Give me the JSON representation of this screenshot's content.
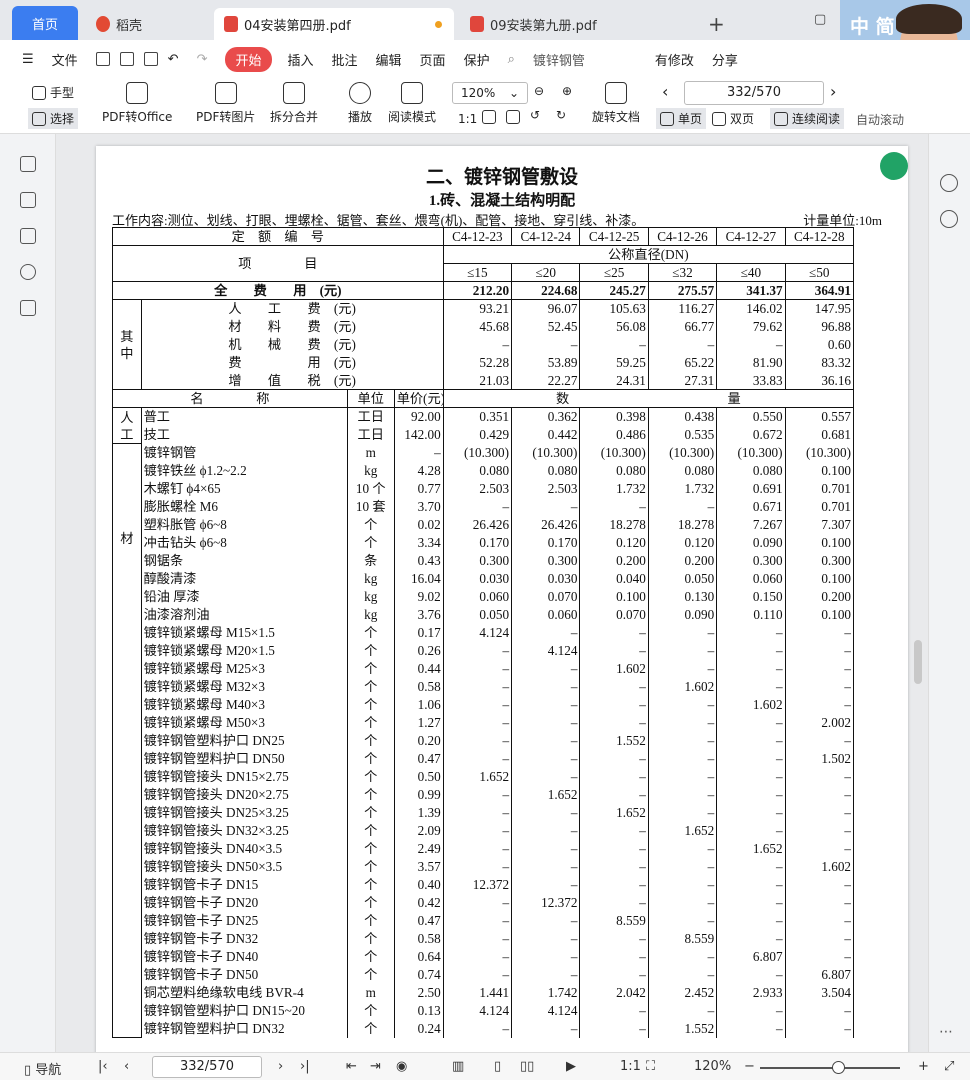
{
  "tabs": {
    "home": "首页",
    "daoke": "稻壳",
    "doc4": "04安装第四册.pdf",
    "doc9": "09安装第九册.pdf",
    "new": "+"
  },
  "menu": {
    "file": "文件",
    "start": "开始",
    "insert": "插入",
    "annotate": "批注",
    "edit": "编辑",
    "page": "页面",
    "protect": "保护",
    "search_text": "镀锌钢管",
    "modified": "有修改",
    "share": "分享"
  },
  "toolbar": {
    "hand": "手型",
    "select": "选择",
    "pdf_office": "PDF转Office",
    "pdf_image": "PDF转图片",
    "split": "拆分合并",
    "play": "播放",
    "read": "阅读模式",
    "zoom": "120%",
    "page_counter": "332/570",
    "rotate": "旋转文档",
    "single": "单页",
    "double": "双页",
    "continuous": "连续阅读",
    "autoscroll": "自动滚动"
  },
  "avatar": {
    "text": "中 简"
  },
  "doc": {
    "title": "二、镀锌钢管敷设",
    "subtitle": "1.砖、混凝土结构明配",
    "work": "工作内容:测位、划线、打眼、埋螺栓、锯管、套丝、煨弯(机)、配管、接地、穿引线、补漆。",
    "unit": "计量单位:10m",
    "codes_label": "定　额　编　号",
    "codes": [
      "C4-12-23",
      "C4-12-24",
      "C4-12-25",
      "C4-12-26",
      "C4-12-27",
      "C4-12-28"
    ],
    "item_label": "项　　　　目",
    "diameter_label": "公称直径(DN)",
    "diameters": [
      "≤15",
      "≤20",
      "≤25",
      "≤32",
      "≤40",
      "≤50"
    ],
    "total_label": "全　　费　　用　(元)",
    "totals": [
      "212.20",
      "224.68",
      "245.27",
      "275.57",
      "341.37",
      "364.91"
    ],
    "among": "其　　中",
    "cost_rows": [
      {
        "name": "人　　工　　费　(元)",
        "v": [
          "93.21",
          "96.07",
          "105.63",
          "116.27",
          "146.02",
          "147.95"
        ]
      },
      {
        "name": "材　　料　　费　(元)",
        "v": [
          "45.68",
          "52.45",
          "56.08",
          "66.77",
          "79.62",
          "96.88"
        ]
      },
      {
        "name": "机　　械　　费　(元)",
        "v": [
          "–",
          "–",
          "–",
          "–",
          "–",
          "0.60"
        ]
      },
      {
        "name": "费　　　　　用　(元)",
        "v": [
          "52.28",
          "53.89",
          "59.25",
          "65.22",
          "81.90",
          "83.32"
        ]
      },
      {
        "name": "增　　值　　税　(元)",
        "v": [
          "21.03",
          "22.27",
          "24.31",
          "27.31",
          "33.83",
          "36.16"
        ]
      }
    ],
    "col_name": "名　　　　称",
    "col_unit": "单位",
    "col_price": "单价(元)",
    "col_qty": "数　　　　　　　　　　　　量",
    "labor_label": "人工",
    "material_label": "材",
    "labor": [
      {
        "name": "普工",
        "unit": "工日",
        "price": "92.00",
        "v": [
          "0.351",
          "0.362",
          "0.398",
          "0.438",
          "0.550",
          "0.557"
        ]
      },
      {
        "name": "技工",
        "unit": "工日",
        "price": "142.00",
        "v": [
          "0.429",
          "0.442",
          "0.486",
          "0.535",
          "0.672",
          "0.681"
        ]
      }
    ],
    "materials": [
      {
        "name": "镀锌钢管",
        "unit": "m",
        "price": "–",
        "v": [
          "(10.300)",
          "(10.300)",
          "(10.300)",
          "(10.300)",
          "(10.300)",
          "(10.300)"
        ]
      },
      {
        "name": "镀锌铁丝 ϕ1.2~2.2",
        "unit": "kg",
        "price": "4.28",
        "v": [
          "0.080",
          "0.080",
          "0.080",
          "0.080",
          "0.080",
          "0.100"
        ]
      },
      {
        "name": "木螺钉 ϕ4×65",
        "unit": "10 个",
        "price": "0.77",
        "v": [
          "2.503",
          "2.503",
          "1.732",
          "1.732",
          "0.691",
          "0.701"
        ]
      },
      {
        "name": "膨胀螺栓 M6",
        "unit": "10 套",
        "price": "3.70",
        "v": [
          "–",
          "–",
          "–",
          "–",
          "0.671",
          "0.701"
        ]
      },
      {
        "name": "塑料胀管 ϕ6~8",
        "unit": "个",
        "price": "0.02",
        "v": [
          "26.426",
          "26.426",
          "18.278",
          "18.278",
          "7.267",
          "7.307"
        ]
      },
      {
        "name": "冲击钻头 ϕ6~8",
        "unit": "个",
        "price": "3.34",
        "v": [
          "0.170",
          "0.170",
          "0.120",
          "0.120",
          "0.090",
          "0.100"
        ]
      },
      {
        "name": "钢锯条",
        "unit": "条",
        "price": "0.43",
        "v": [
          "0.300",
          "0.300",
          "0.200",
          "0.200",
          "0.300",
          "0.300"
        ]
      },
      {
        "name": "醇酸清漆",
        "unit": "kg",
        "price": "16.04",
        "v": [
          "0.030",
          "0.030",
          "0.040",
          "0.050",
          "0.060",
          "0.100"
        ]
      },
      {
        "name": "铅油 厚漆",
        "unit": "kg",
        "price": "9.02",
        "v": [
          "0.060",
          "0.070",
          "0.100",
          "0.130",
          "0.150",
          "0.200"
        ]
      },
      {
        "name": "油漆溶剂油",
        "unit": "kg",
        "price": "3.76",
        "v": [
          "0.050",
          "0.060",
          "0.070",
          "0.090",
          "0.110",
          "0.100"
        ]
      },
      {
        "name": "镀锌锁紧螺母 M15×1.5",
        "unit": "个",
        "price": "0.17",
        "v": [
          "4.124",
          "–",
          "–",
          "–",
          "–",
          "–"
        ]
      },
      {
        "name": "镀锌锁紧螺母 M20×1.5",
        "unit": "个",
        "price": "0.26",
        "v": [
          "–",
          "4.124",
          "–",
          "–",
          "–",
          "–"
        ]
      },
      {
        "name": "镀锌锁紧螺母 M25×3",
        "unit": "个",
        "price": "0.44",
        "v": [
          "–",
          "–",
          "1.602",
          "–",
          "–",
          "–"
        ]
      },
      {
        "name": "镀锌锁紧螺母 M32×3",
        "unit": "个",
        "price": "0.58",
        "v": [
          "–",
          "–",
          "–",
          "1.602",
          "–",
          "–"
        ]
      },
      {
        "name": "镀锌锁紧螺母 M40×3",
        "unit": "个",
        "price": "1.06",
        "v": [
          "–",
          "–",
          "–",
          "–",
          "1.602",
          "–"
        ]
      },
      {
        "name": "镀锌锁紧螺母 M50×3",
        "unit": "个",
        "price": "1.27",
        "v": [
          "–",
          "–",
          "–",
          "–",
          "–",
          "2.002"
        ]
      },
      {
        "name": "镀锌钢管塑料护口 DN25",
        "unit": "个",
        "price": "0.20",
        "v": [
          "–",
          "–",
          "1.552",
          "–",
          "–",
          "–"
        ]
      },
      {
        "name": "镀锌钢管塑料护口 DN50",
        "unit": "个",
        "price": "0.47",
        "v": [
          "–",
          "–",
          "–",
          "–",
          "–",
          "1.502"
        ]
      },
      {
        "name": "镀锌钢管接头 DN15×2.75",
        "unit": "个",
        "price": "0.50",
        "v": [
          "1.652",
          "–",
          "–",
          "–",
          "–",
          "–"
        ]
      },
      {
        "name": "镀锌钢管接头 DN20×2.75",
        "unit": "个",
        "price": "0.99",
        "v": [
          "–",
          "1.652",
          "–",
          "–",
          "–",
          "–"
        ]
      },
      {
        "name": "镀锌钢管接头 DN25×3.25",
        "unit": "个",
        "price": "1.39",
        "v": [
          "–",
          "–",
          "1.652",
          "–",
          "–",
          "–"
        ]
      },
      {
        "name": "镀锌钢管接头 DN32×3.25",
        "unit": "个",
        "price": "2.09",
        "v": [
          "–",
          "–",
          "–",
          "1.652",
          "–",
          "–"
        ]
      },
      {
        "name": "镀锌钢管接头 DN40×3.5",
        "unit": "个",
        "price": "2.49",
        "v": [
          "–",
          "–",
          "–",
          "–",
          "1.652",
          "–"
        ]
      },
      {
        "name": "镀锌钢管接头 DN50×3.5",
        "unit": "个",
        "price": "3.57",
        "v": [
          "–",
          "–",
          "–",
          "–",
          "–",
          "1.602"
        ]
      },
      {
        "name": "镀锌钢管卡子 DN15",
        "unit": "个",
        "price": "0.40",
        "v": [
          "12.372",
          "–",
          "–",
          "–",
          "–",
          "–"
        ]
      },
      {
        "name": "镀锌钢管卡子 DN20",
        "unit": "个",
        "price": "0.42",
        "v": [
          "–",
          "12.372",
          "–",
          "–",
          "–",
          "–"
        ]
      },
      {
        "name": "镀锌钢管卡子 DN25",
        "unit": "个",
        "price": "0.47",
        "v": [
          "–",
          "–",
          "8.559",
          "–",
          "–",
          "–"
        ]
      },
      {
        "name": "镀锌钢管卡子 DN32",
        "unit": "个",
        "price": "0.58",
        "v": [
          "–",
          "–",
          "–",
          "8.559",
          "–",
          "–"
        ]
      },
      {
        "name": "镀锌钢管卡子 DN40",
        "unit": "个",
        "price": "0.64",
        "v": [
          "–",
          "–",
          "–",
          "–",
          "6.807",
          "–"
        ]
      },
      {
        "name": "镀锌钢管卡子 DN50",
        "unit": "个",
        "price": "0.74",
        "v": [
          "–",
          "–",
          "–",
          "–",
          "–",
          "6.807"
        ]
      },
      {
        "name": "铜芯塑料绝缘软电线 BVR-4",
        "unit": "m",
        "price": "2.50",
        "v": [
          "1.441",
          "1.742",
          "2.042",
          "2.452",
          "2.933",
          "3.504"
        ]
      },
      {
        "name": "镀锌钢管塑料护口 DN15~20",
        "unit": "个",
        "price": "0.13",
        "v": [
          "4.124",
          "4.124",
          "–",
          "–",
          "–",
          "–"
        ]
      },
      {
        "name": "镀锌钢管塑料护口 DN32",
        "unit": "个",
        "price": "0.24",
        "v": [
          "–",
          "–",
          "–",
          "1.552",
          "–",
          "–"
        ]
      }
    ]
  },
  "status": {
    "nav": "导航",
    "page": "332/570",
    "zoom": "120%"
  }
}
